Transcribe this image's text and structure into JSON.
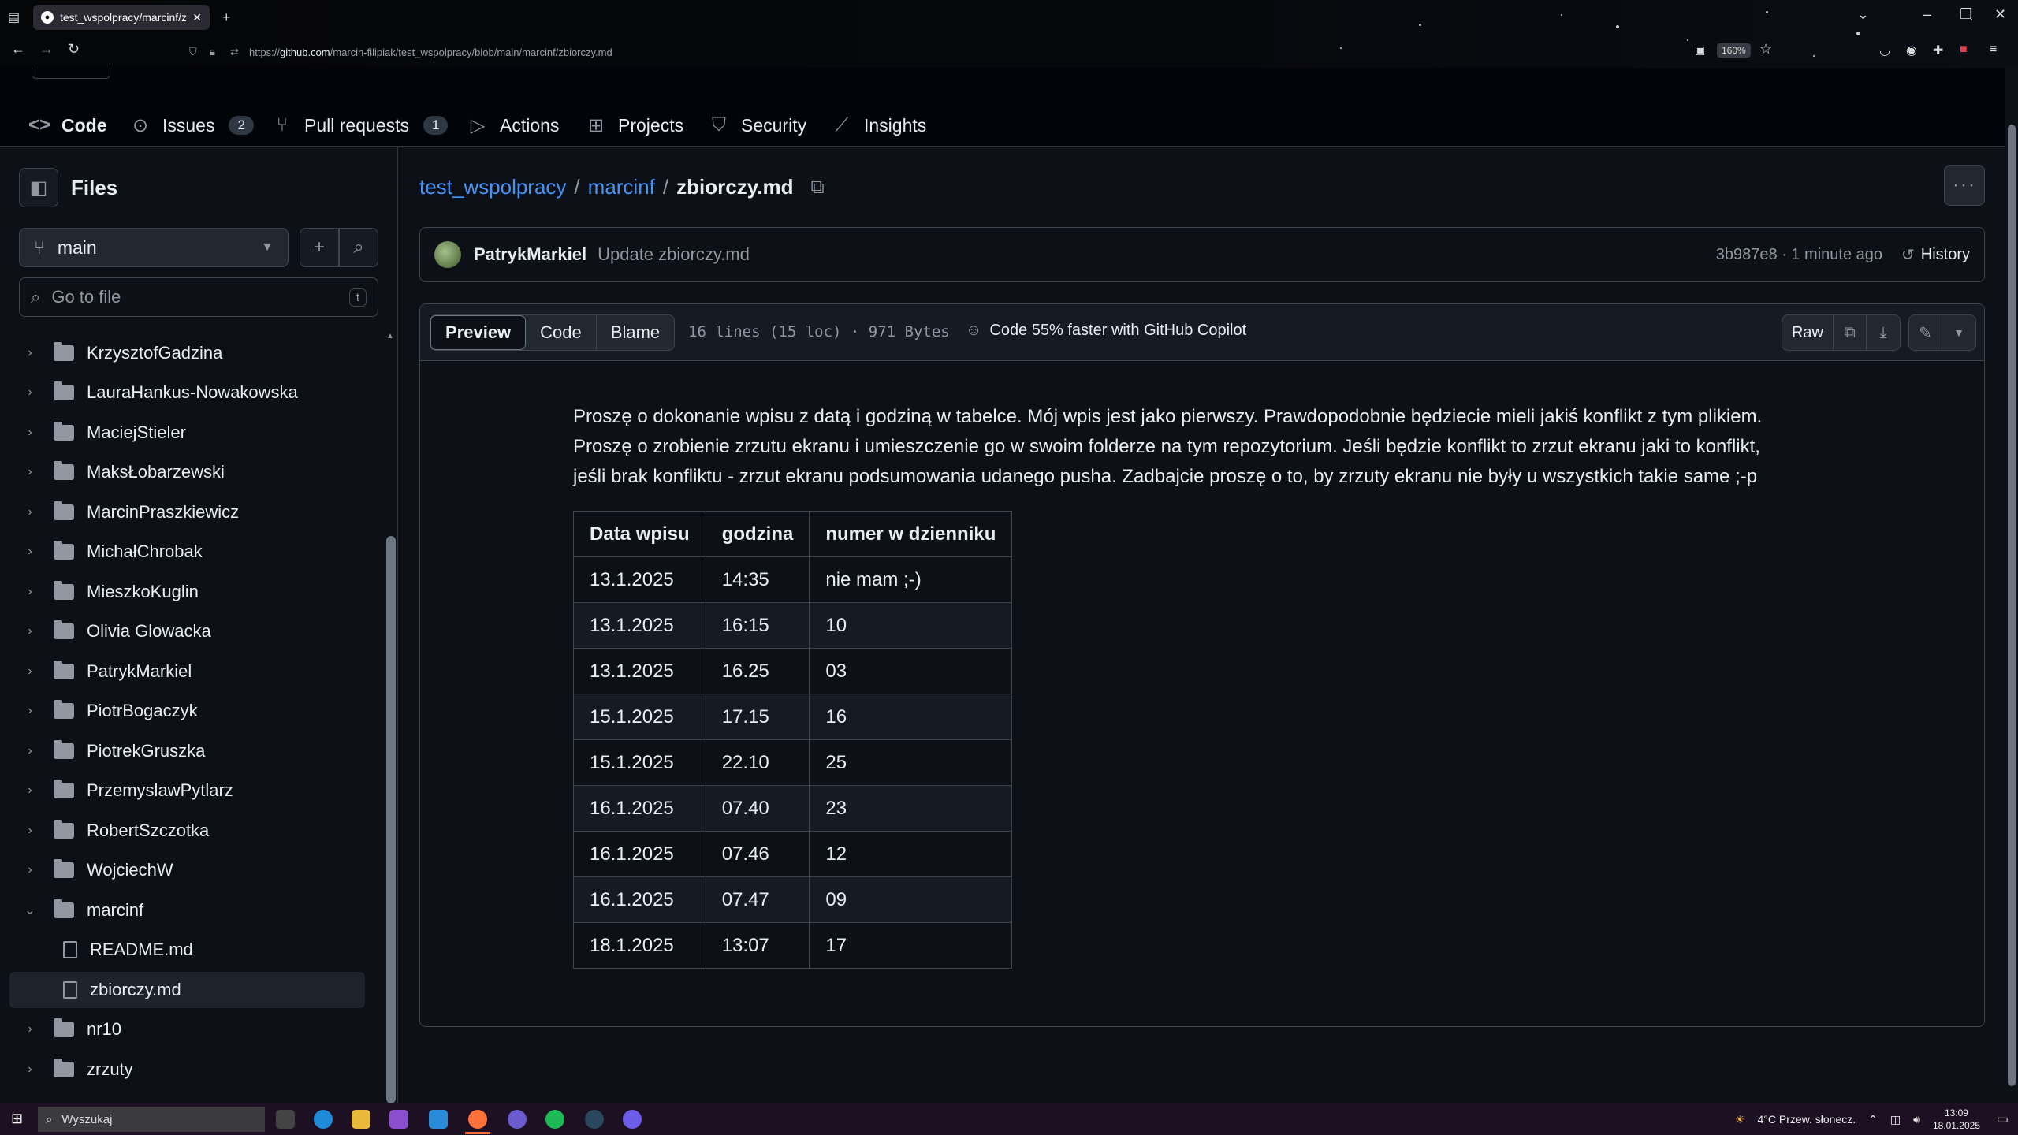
{
  "browser": {
    "tab_title": "test_wspolpracy/marcinf/zbior",
    "url_prefix": "https://",
    "url_host": "github.com",
    "url_path": "/marcin-filipiak/test_wspolpracy/blob/main/marcinf/zbiorczy.md",
    "zoom": "160%"
  },
  "repo_nav": {
    "tabs": [
      {
        "label": "Code",
        "icon": "code-icon",
        "count": null,
        "active": true
      },
      {
        "label": "Issues",
        "icon": "issue-icon",
        "count": "2",
        "active": false
      },
      {
        "label": "Pull requests",
        "icon": "pull-request-icon",
        "count": "1",
        "active": false
      },
      {
        "label": "Actions",
        "icon": "play-icon",
        "count": null,
        "active": false
      },
      {
        "label": "Projects",
        "icon": "table-icon",
        "count": null,
        "active": false
      },
      {
        "label": "Security",
        "icon": "shield-icon",
        "count": null,
        "active": false
      },
      {
        "label": "Insights",
        "icon": "graph-icon",
        "count": null,
        "active": false
      }
    ]
  },
  "sidebar": {
    "title": "Files",
    "branch": "main",
    "goto_placeholder": "Go to file",
    "goto_shortcut": "t",
    "tree": [
      {
        "name": "KrzysztofGadzina",
        "type": "folder",
        "expanded": false
      },
      {
        "name": "LauraHankus-Nowakowska",
        "type": "folder",
        "expanded": false
      },
      {
        "name": "MaciejStieler",
        "type": "folder",
        "expanded": false
      },
      {
        "name": "MaksŁobarzewski",
        "type": "folder",
        "expanded": false
      },
      {
        "name": "MarcinPraszkiewicz",
        "type": "folder",
        "expanded": false
      },
      {
        "name": "MichałChrobak",
        "type": "folder",
        "expanded": false
      },
      {
        "name": "MieszkoKuglin",
        "type": "folder",
        "expanded": false
      },
      {
        "name": "Olivia Glowacka",
        "type": "folder",
        "expanded": false
      },
      {
        "name": "PatrykMarkiel",
        "type": "folder",
        "expanded": false
      },
      {
        "name": "PiotrBogaczyk",
        "type": "folder",
        "expanded": false
      },
      {
        "name": "PiotrekGruszka",
        "type": "folder",
        "expanded": false
      },
      {
        "name": "PrzemyslawPytlarz",
        "type": "folder",
        "expanded": false
      },
      {
        "name": "RobertSzczotka",
        "type": "folder",
        "expanded": false
      },
      {
        "name": "WojciechW",
        "type": "folder",
        "expanded": false
      },
      {
        "name": "marcinf",
        "type": "folder",
        "expanded": true
      },
      {
        "name": "README.md",
        "type": "file",
        "selected": false
      },
      {
        "name": "zbiorczy.md",
        "type": "file",
        "selected": true
      },
      {
        "name": "nr10",
        "type": "folder",
        "expanded": false
      },
      {
        "name": "zrzuty",
        "type": "folder",
        "expanded": false
      }
    ]
  },
  "breadcrumb": {
    "repo": "test_wspolpracy",
    "sep": "/",
    "folder": "marcinf",
    "file": "zbiorczy.md"
  },
  "commit": {
    "author": "PatrykMarkiel",
    "message": "Update zbiorczy.md",
    "meta": "3b987e8 · 1 minute ago",
    "history": "History"
  },
  "file_header": {
    "tabs": [
      "Preview",
      "Code",
      "Blame"
    ],
    "info": "16 lines (15 loc) · 971 Bytes",
    "copilot": "Code 55% faster with GitHub Copilot",
    "raw": "Raw"
  },
  "content": {
    "paragraph_lines": [
      "Proszę o dokonanie wpisu z datą i godziną w tabelce. Mój wpis jest jako pierwszy. Prawdopodobnie będziecie mieli jakiś konflikt z tym plikiem.",
      "Proszę o zrobienie zrzutu ekranu i umieszczenie go w swoim folderze na tym repozytorium. Jeśli będzie konflikt to zrzut ekranu jaki to konflikt,",
      "jeśli brak konfliktu - zrzut ekranu podsumowania udanego pusha. Zadbajcie proszę o to, by zrzuty ekranu nie były u wszystkich takie same ;-p"
    ],
    "table": {
      "headers": [
        "Data wpisu",
        "godzina",
        "numer w dzienniku"
      ],
      "rows": [
        [
          "13.1.2025",
          "14:35",
          "nie mam ;-)"
        ],
        [
          "13.1.2025",
          "16:15",
          "10"
        ],
        [
          "13.1.2025",
          "16.25",
          "03"
        ],
        [
          "15.1.2025",
          "17.15",
          "16"
        ],
        [
          "15.1.2025",
          "22.10",
          "25"
        ],
        [
          "16.1.2025",
          "07.40",
          "23"
        ],
        [
          "16.1.2025",
          "07.46",
          "12"
        ],
        [
          "16.1.2025",
          "07.47",
          "09"
        ],
        [
          "18.1.2025",
          "13:07",
          "17"
        ]
      ]
    }
  },
  "taskbar": {
    "search_placeholder": "Wyszukaj",
    "weather": "4°C  Przew. słonecz.",
    "time": "13:09",
    "date": "18.01.2025"
  },
  "colors": {
    "link": "#4493f8",
    "accent_underline": "#f78166",
    "bg": "#0d1117"
  }
}
